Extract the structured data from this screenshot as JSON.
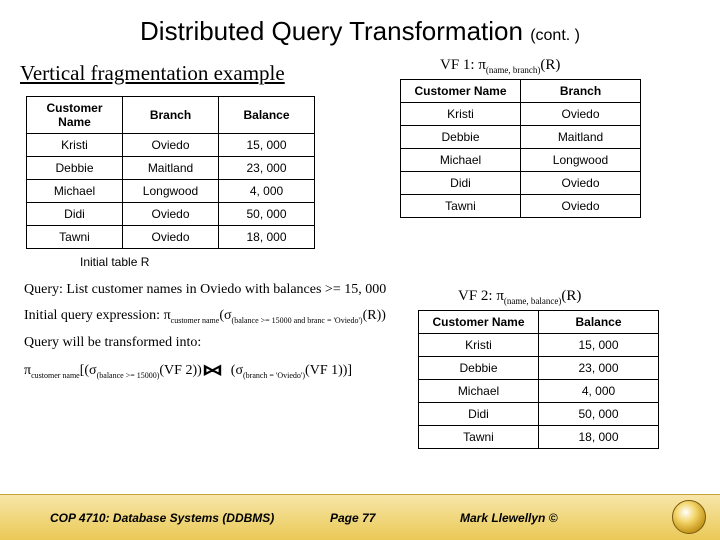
{
  "title_main": "Distributed Query Transformation",
  "title_cont": "(cont. )",
  "subtitle": "Vertical fragmentation example",
  "table_main": {
    "headers": [
      "Customer Name",
      "Branch",
      "Balance"
    ],
    "rows": [
      [
        "Kristi",
        "Oviedo",
        "15, 000"
      ],
      [
        "Debbie",
        "Maitland",
        "23, 000"
      ],
      [
        "Michael",
        "Longwood",
        "4, 000"
      ],
      [
        "Didi",
        "Oviedo",
        "50, 000"
      ],
      [
        "Tawni",
        "Oviedo",
        "18, 000"
      ]
    ]
  },
  "caption_main": "Initial table R",
  "vf1": {
    "label_pre": "VF 1: π",
    "label_sub": "(name, branch)",
    "label_post": "(R)",
    "headers": [
      "Customer Name",
      "Branch"
    ],
    "rows": [
      [
        "Kristi",
        "Oviedo"
      ],
      [
        "Debbie",
        "Maitland"
      ],
      [
        "Michael",
        "Longwood"
      ],
      [
        "Didi",
        "Oviedo"
      ],
      [
        "Tawni",
        "Oviedo"
      ]
    ]
  },
  "vf2": {
    "label_pre": "VF 2: π",
    "label_sub": "(name, balance)",
    "label_post": "(R)",
    "headers": [
      "Customer Name",
      "Balance"
    ],
    "rows": [
      [
        "Kristi",
        "15, 000"
      ],
      [
        "Debbie",
        "23, 000"
      ],
      [
        "Michael",
        "4, 000"
      ],
      [
        "Didi",
        "50, 000"
      ],
      [
        "Tawni",
        "18, 000"
      ]
    ]
  },
  "body": {
    "line1": "Query: List customer names in Oviedo with balances >= 15, 000",
    "line2a": "Initial query expression: π",
    "line2sub1": "customer name",
    "line2b": "(σ",
    "line2sub2": "(balance >= 15000 and branc = 'Oviedo')",
    "line2c": "(R))",
    "line3": "Query will be transformed into:",
    "line4a": "π",
    "line4sub1": "customer name",
    "line4b": "[(σ",
    "line4sub2": "(balance >= 15000)",
    "line4c": "(VF 2))",
    "line4join": "⋈",
    "line4d": "(σ",
    "line4sub3": "(branch = 'Oviedo')",
    "line4e": "(VF 1))]"
  },
  "footer": {
    "course": "COP 4710: Database Systems  (DDBMS)",
    "page": "Page 77",
    "author": "Mark Llewellyn ©"
  }
}
